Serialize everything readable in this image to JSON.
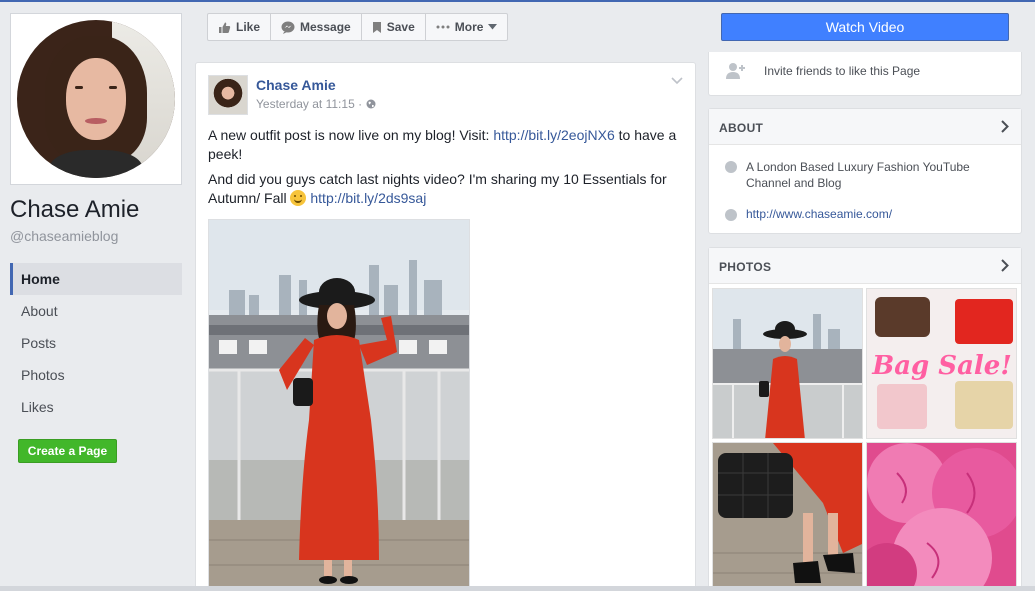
{
  "page": {
    "name": "Chase Amie",
    "handle": "@chaseamieblog"
  },
  "nav": {
    "items": [
      {
        "label": "Home",
        "active": true
      },
      {
        "label": "About",
        "active": false
      },
      {
        "label": "Posts",
        "active": false
      },
      {
        "label": "Photos",
        "active": false
      },
      {
        "label": "Likes",
        "active": false
      }
    ],
    "create_page": "Create a Page"
  },
  "actions": {
    "like": "Like",
    "message": "Message",
    "save": "Save",
    "more": "More",
    "watch_video": "Watch Video"
  },
  "post": {
    "author": "Chase Amie",
    "time": "Yesterday at 11:15 ·",
    "line1_before": "A new outfit post is now live on my blog! Visit: ",
    "line1_link": "http://bit.ly/2eojNX6",
    "line1_after": " to have a peek!",
    "line2_before": "And did you guys catch last nights video? I'm sharing my 10 Essentials for Autumn/ Fall ",
    "line2_link": "http://bit.ly/2ds9saj"
  },
  "sidebar": {
    "invite": "Invite friends to like this Page",
    "about_title": "ABOUT",
    "about_desc": "A London Based Luxury Fashion YouTube Channel and Blog",
    "about_url": "http://www.chaseamie.com/",
    "photos_title": "PHOTOS",
    "bag_sale_text": "Bag Sale!"
  },
  "colors": {
    "brand_blue": "#4267b2",
    "link_blue": "#365899",
    "watch_button": "#4080ff",
    "create_green": "#42b72a"
  }
}
